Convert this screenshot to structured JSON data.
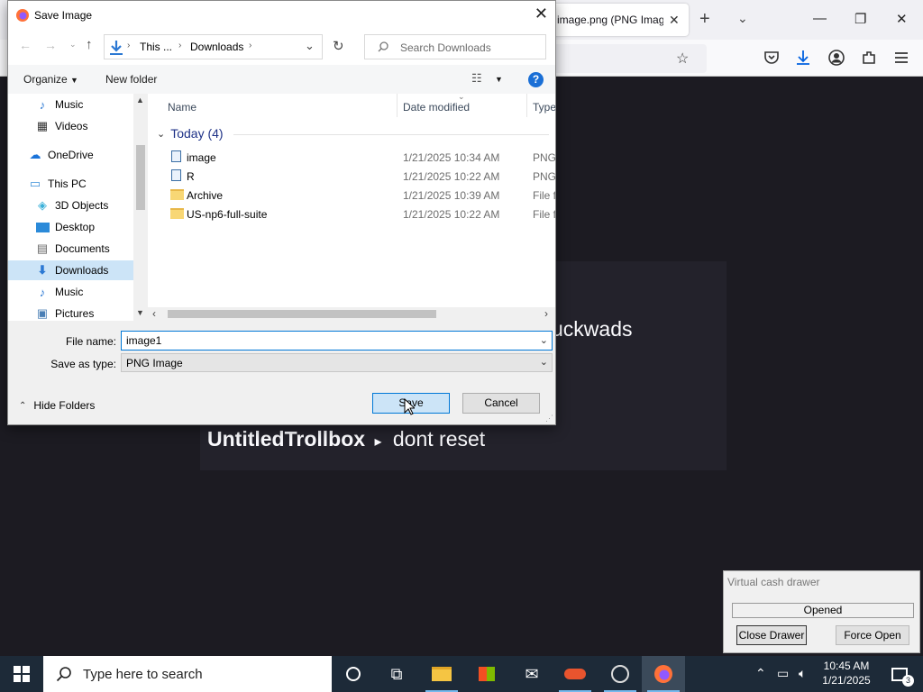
{
  "browser": {
    "tab_title": "image.png (PNG Imag…",
    "content_text_1": "uckwads",
    "content_line_bold": "UntitledTrollbox",
    "content_line_arrow": "▸",
    "content_line_text": "dont reset"
  },
  "dialog": {
    "title": "Save Image",
    "breadcrumb": [
      "This ...",
      "Downloads"
    ],
    "search_placeholder": "Search Downloads",
    "toolbar": {
      "organize": "Organize",
      "new_folder": "New folder"
    },
    "nav_items": [
      {
        "label": "Music",
        "icon": "music-icon"
      },
      {
        "label": "Videos",
        "icon": "videos-icon"
      },
      {
        "label": "OneDrive",
        "icon": "onedrive-icon"
      },
      {
        "label": "This PC",
        "icon": "pc-icon"
      },
      {
        "label": "3D Objects",
        "icon": "3d-objects-icon"
      },
      {
        "label": "Desktop",
        "icon": "desktop-icon"
      },
      {
        "label": "Documents",
        "icon": "documents-icon"
      },
      {
        "label": "Downloads",
        "icon": "downloads-icon",
        "selected": true
      },
      {
        "label": "Music",
        "icon": "music-icon"
      },
      {
        "label": "Pictures",
        "icon": "pictures-icon"
      }
    ],
    "columns": {
      "name": "Name",
      "date_modified": "Date modified",
      "type": "Type"
    },
    "group_header": "Today (4)",
    "files": [
      {
        "name": "image",
        "date": "1/21/2025 10:34 AM",
        "type": "PNG",
        "kind": "image"
      },
      {
        "name": "R",
        "date": "1/21/2025 10:22 AM",
        "type": "PNG",
        "kind": "image"
      },
      {
        "name": "Archive",
        "date": "1/21/2025 10:39 AM",
        "type": "File fo",
        "kind": "folder"
      },
      {
        "name": "US-np6-full-suite",
        "date": "1/21/2025 10:22 AM",
        "type": "File fo",
        "kind": "folder"
      }
    ],
    "file_name_label": "File name:",
    "file_name_value": "image1",
    "save_type_label": "Save as type:",
    "save_type_value": "PNG Image",
    "hide_folders": "Hide Folders",
    "save_button": "Save",
    "cancel_button": "Cancel"
  },
  "cash_drawer": {
    "title": "Virtual cash drawer",
    "status": "Opened",
    "close_button": "Close Drawer",
    "force_button": "Force Open"
  },
  "taskbar": {
    "search_placeholder": "Type here to search",
    "time": "10:45 AM",
    "date": "1/21/2025",
    "notification_count": "3"
  }
}
